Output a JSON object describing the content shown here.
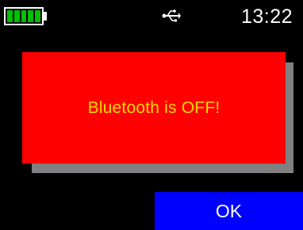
{
  "status_bar": {
    "battery": {
      "level": 1.0,
      "segments": 5,
      "color": "#00c000"
    },
    "usb_icon": "usb-icon",
    "time": "13:22"
  },
  "dialog": {
    "message": "Bluetooth is OFF!",
    "background": "#ff0000",
    "text_color": "#ffd700",
    "shadow_color": "#808080"
  },
  "actions": {
    "ok_label": "OK",
    "ok_color": "#0000ff"
  }
}
